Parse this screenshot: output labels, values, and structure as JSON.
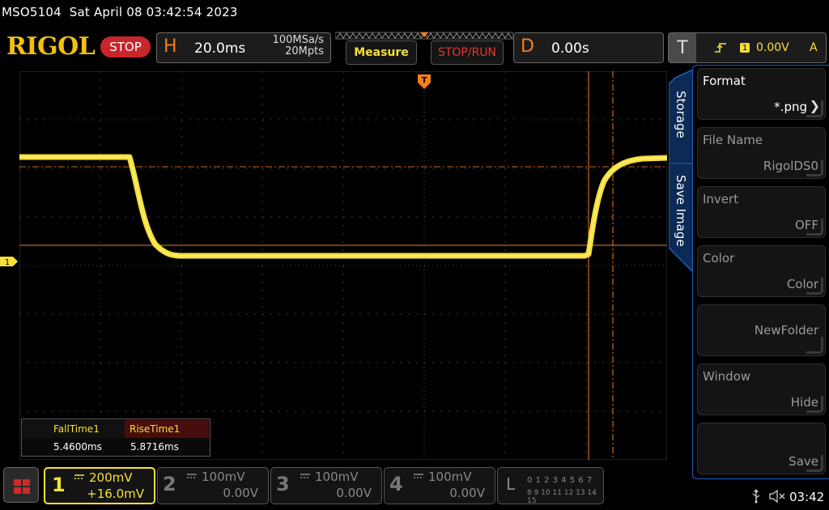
{
  "status": {
    "model": "MSO5104",
    "datetime": "Sat April 08 03:42:54 2023"
  },
  "brand": {
    "logo": "RIGOL",
    "run_state": "STOP"
  },
  "horizontal": {
    "label": "H",
    "timebase": "20.0ms",
    "sample_rate": "100MSa/s",
    "memory_depth": "20Mpts"
  },
  "buttons": {
    "measure": "Measure",
    "stop_run": "STOP/RUN"
  },
  "delay": {
    "label": "D",
    "value": "0.00s"
  },
  "trigger": {
    "label": "T",
    "source": "1",
    "level": "0.00V",
    "mode": "A",
    "marker": "T",
    "edge_icon": "rising-edge-icon"
  },
  "channel_marker": "1",
  "measurements": {
    "fall_label": "FallTime1",
    "fall_value": "5.4600ms",
    "rise_label": "RiseTime1",
    "rise_value": "5.8716ms"
  },
  "side_menu": {
    "tab_storage": "Storage",
    "tab_save_image": "Save Image",
    "items": [
      {
        "title": "Format",
        "value": "*.png"
      },
      {
        "title": "File Name",
        "value": "RigolDS0"
      },
      {
        "title": "Invert",
        "value": "OFF"
      },
      {
        "title": "Color",
        "value": "Color"
      },
      {
        "title": "",
        "value": "NewFolder"
      },
      {
        "title": "Window",
        "value": "Hide"
      },
      {
        "title": "",
        "value": "Save"
      }
    ]
  },
  "channels": [
    {
      "num": "1",
      "scale": "200mV",
      "offset": "+16.0mV"
    },
    {
      "num": "2",
      "scale": "100mV",
      "offset": "0.00V"
    },
    {
      "num": "3",
      "scale": "100mV",
      "offset": "0.00V"
    },
    {
      "num": "4",
      "scale": "100mV",
      "offset": "0.00V"
    }
  ],
  "logic": {
    "label": "L",
    "row1": "0 1 2 3  4 5 6 7",
    "row2": "8  9 10 11  12 13 14 15"
  },
  "clock": "03:42",
  "colors": {
    "ch1": "#f6e03a",
    "accent": "#f47e1e",
    "menu_border": "#1f5fbf",
    "stop": "#c8262a"
  }
}
